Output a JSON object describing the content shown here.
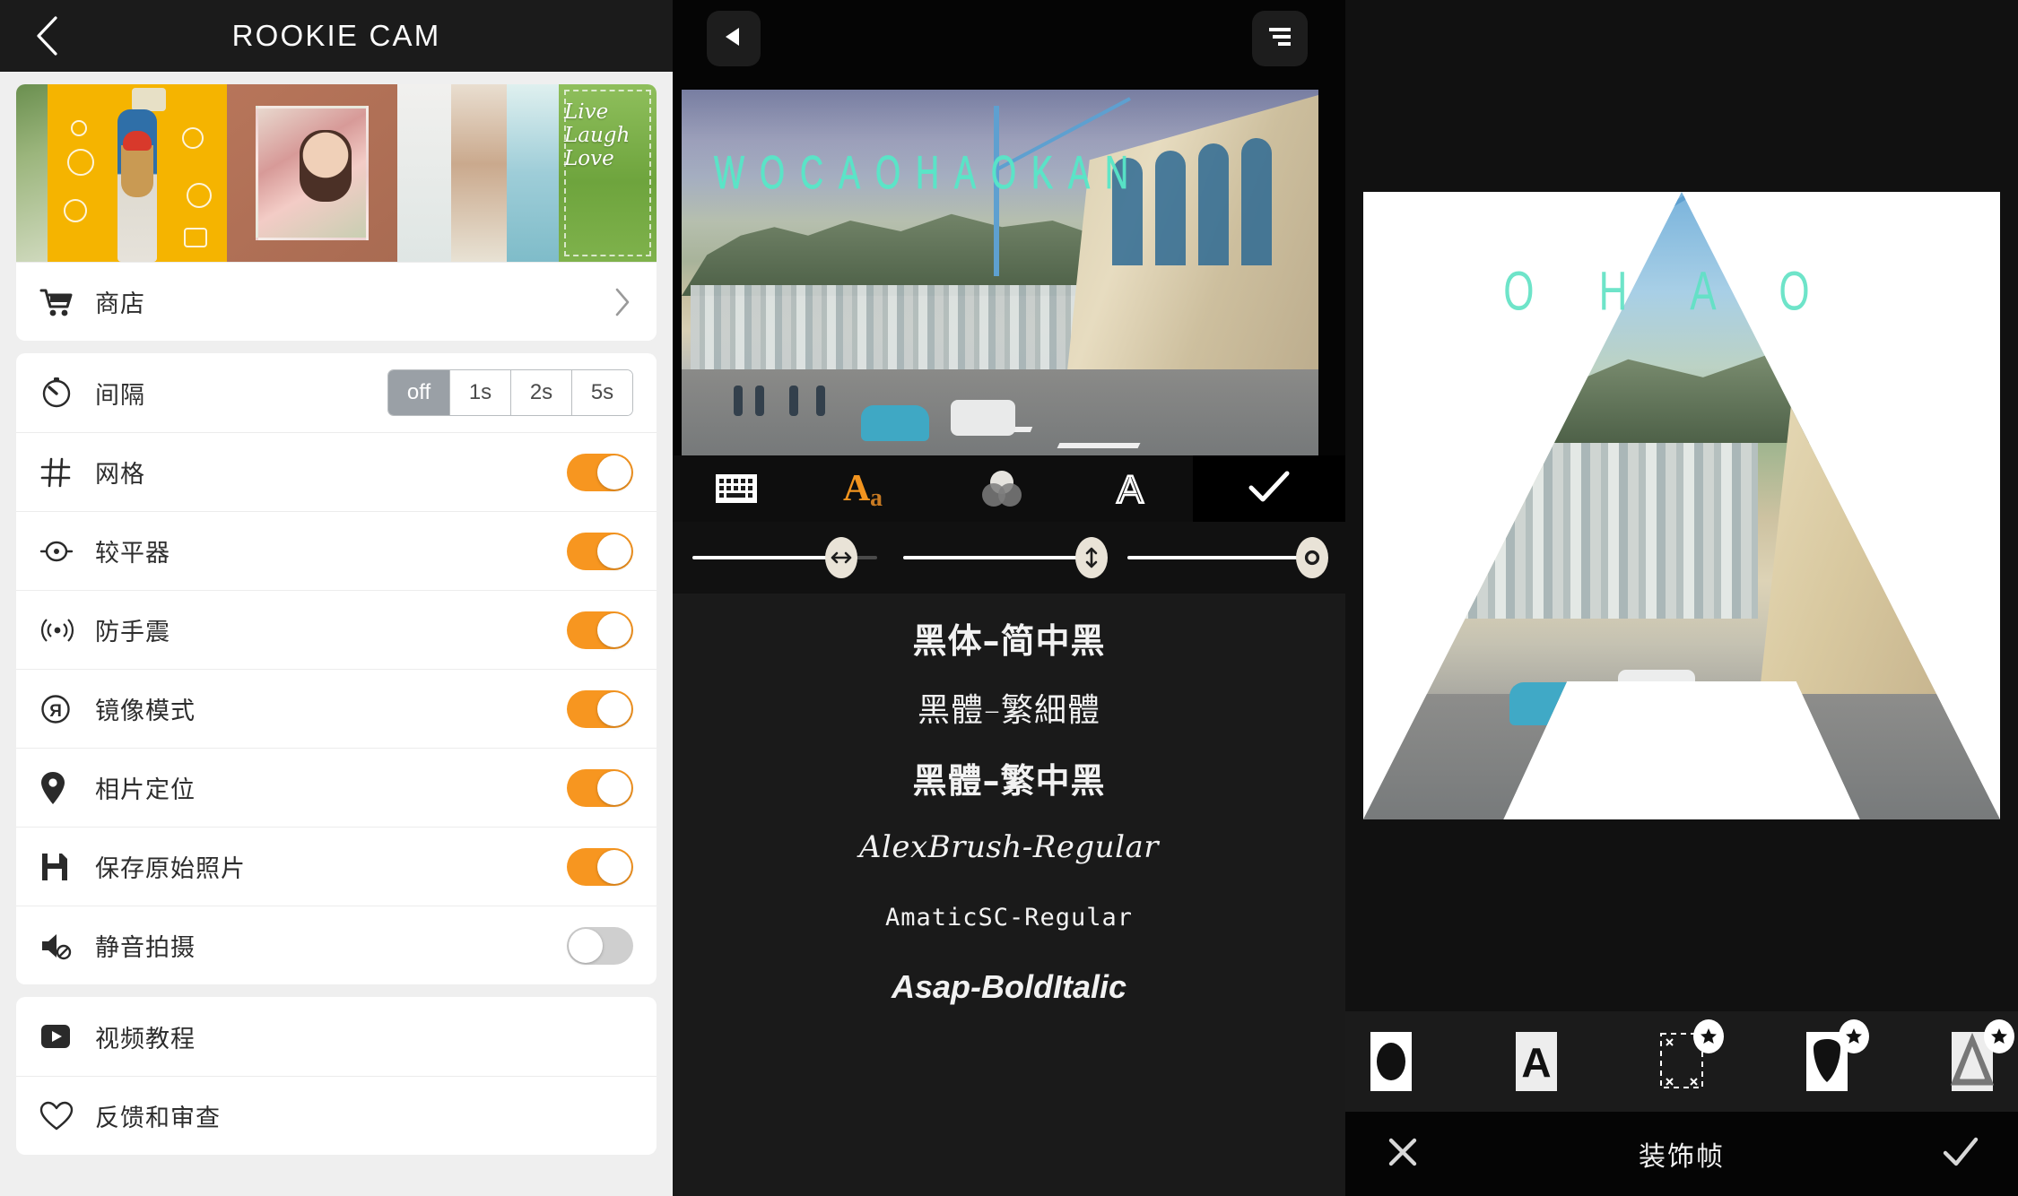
{
  "left": {
    "header": {
      "title": "ROOKIE CAM",
      "back_icon": "chevron-left-icon"
    },
    "banner": {
      "promo_text": "Live\nLaugh\nLove"
    },
    "shop": {
      "label": "商店",
      "icon": "shopping-cart-icon",
      "chevron": "chevron-right-icon"
    },
    "interval": {
      "label": "间隔",
      "icon": "timer-icon",
      "options": [
        "off",
        "1s",
        "2s",
        "5s"
      ],
      "selected": "off"
    },
    "toggles": [
      {
        "label": "网格",
        "icon": "grid-icon",
        "state": "on"
      },
      {
        "label": "较平器",
        "icon": "level-icon",
        "state": "on"
      },
      {
        "label": "防手震",
        "icon": "stabilizer-icon",
        "state": "on"
      },
      {
        "label": "镜像模式",
        "icon": "mirror-icon",
        "state": "on"
      },
      {
        "label": "相片定位",
        "icon": "location-pin-icon",
        "state": "on"
      },
      {
        "label": "保存原始照片",
        "icon": "save-icon",
        "state": "on"
      },
      {
        "label": "静音拍摄",
        "icon": "mute-icon",
        "state": "off"
      }
    ],
    "links": [
      {
        "label": "视频教程",
        "icon": "play-video-icon"
      },
      {
        "label": "反馈和审查",
        "icon": "heart-icon"
      }
    ]
  },
  "middle": {
    "back_button_icon": "play-back-triangle-icon",
    "align_button_icon": "text-align-right-icon",
    "overlay_text": "WOCAOHAOKAN",
    "overlay_color": "#58e7c8",
    "tools": [
      {
        "name": "keyboard-icon",
        "label": "keyboard",
        "active": false
      },
      {
        "name": "font-Aa-icon",
        "label": "Aa",
        "active": true
      },
      {
        "name": "color-blend-icon",
        "label": "color",
        "active": false
      },
      {
        "name": "outline-A-icon",
        "label": "A",
        "active": false
      }
    ],
    "confirm_icon": "check-icon",
    "sliders": [
      {
        "name": "letter-spacing-slider",
        "icon": "horizontal-arrows-icon",
        "value": 78
      },
      {
        "name": "line-height-slider",
        "icon": "vertical-arrows-icon",
        "value": 100
      },
      {
        "name": "opacity-slider",
        "icon": "circle-icon",
        "value": 100
      }
    ],
    "fonts": [
      "黑体–简中黑",
      "黑體–繁細體",
      "黑體–繁中黑",
      "AlexBrush-Regular",
      "AmaticSC-Regular",
      "Asap-BoldItalic"
    ]
  },
  "right": {
    "canvas_letter": "A",
    "canvas_overlay_text": "O H A O",
    "frame_tools": [
      {
        "name": "shape-circle-icon",
        "badge": false
      },
      {
        "name": "shape-letter-A-icon",
        "badge": false
      },
      {
        "name": "sparkle-frame-icon",
        "badge": true
      },
      {
        "name": "shield-shape-icon",
        "badge": true
      },
      {
        "name": "triangle-shape-icon",
        "badge": true
      }
    ],
    "bottom_bar": {
      "cancel_icon": "close-x-icon",
      "title": "装饰帧",
      "confirm_icon": "check-icon"
    }
  },
  "colors": {
    "accent_orange": "#f79620",
    "teal_text": "#58e7c8",
    "panel_dark": "#1a1a1a",
    "list_bg": "#efefef"
  }
}
